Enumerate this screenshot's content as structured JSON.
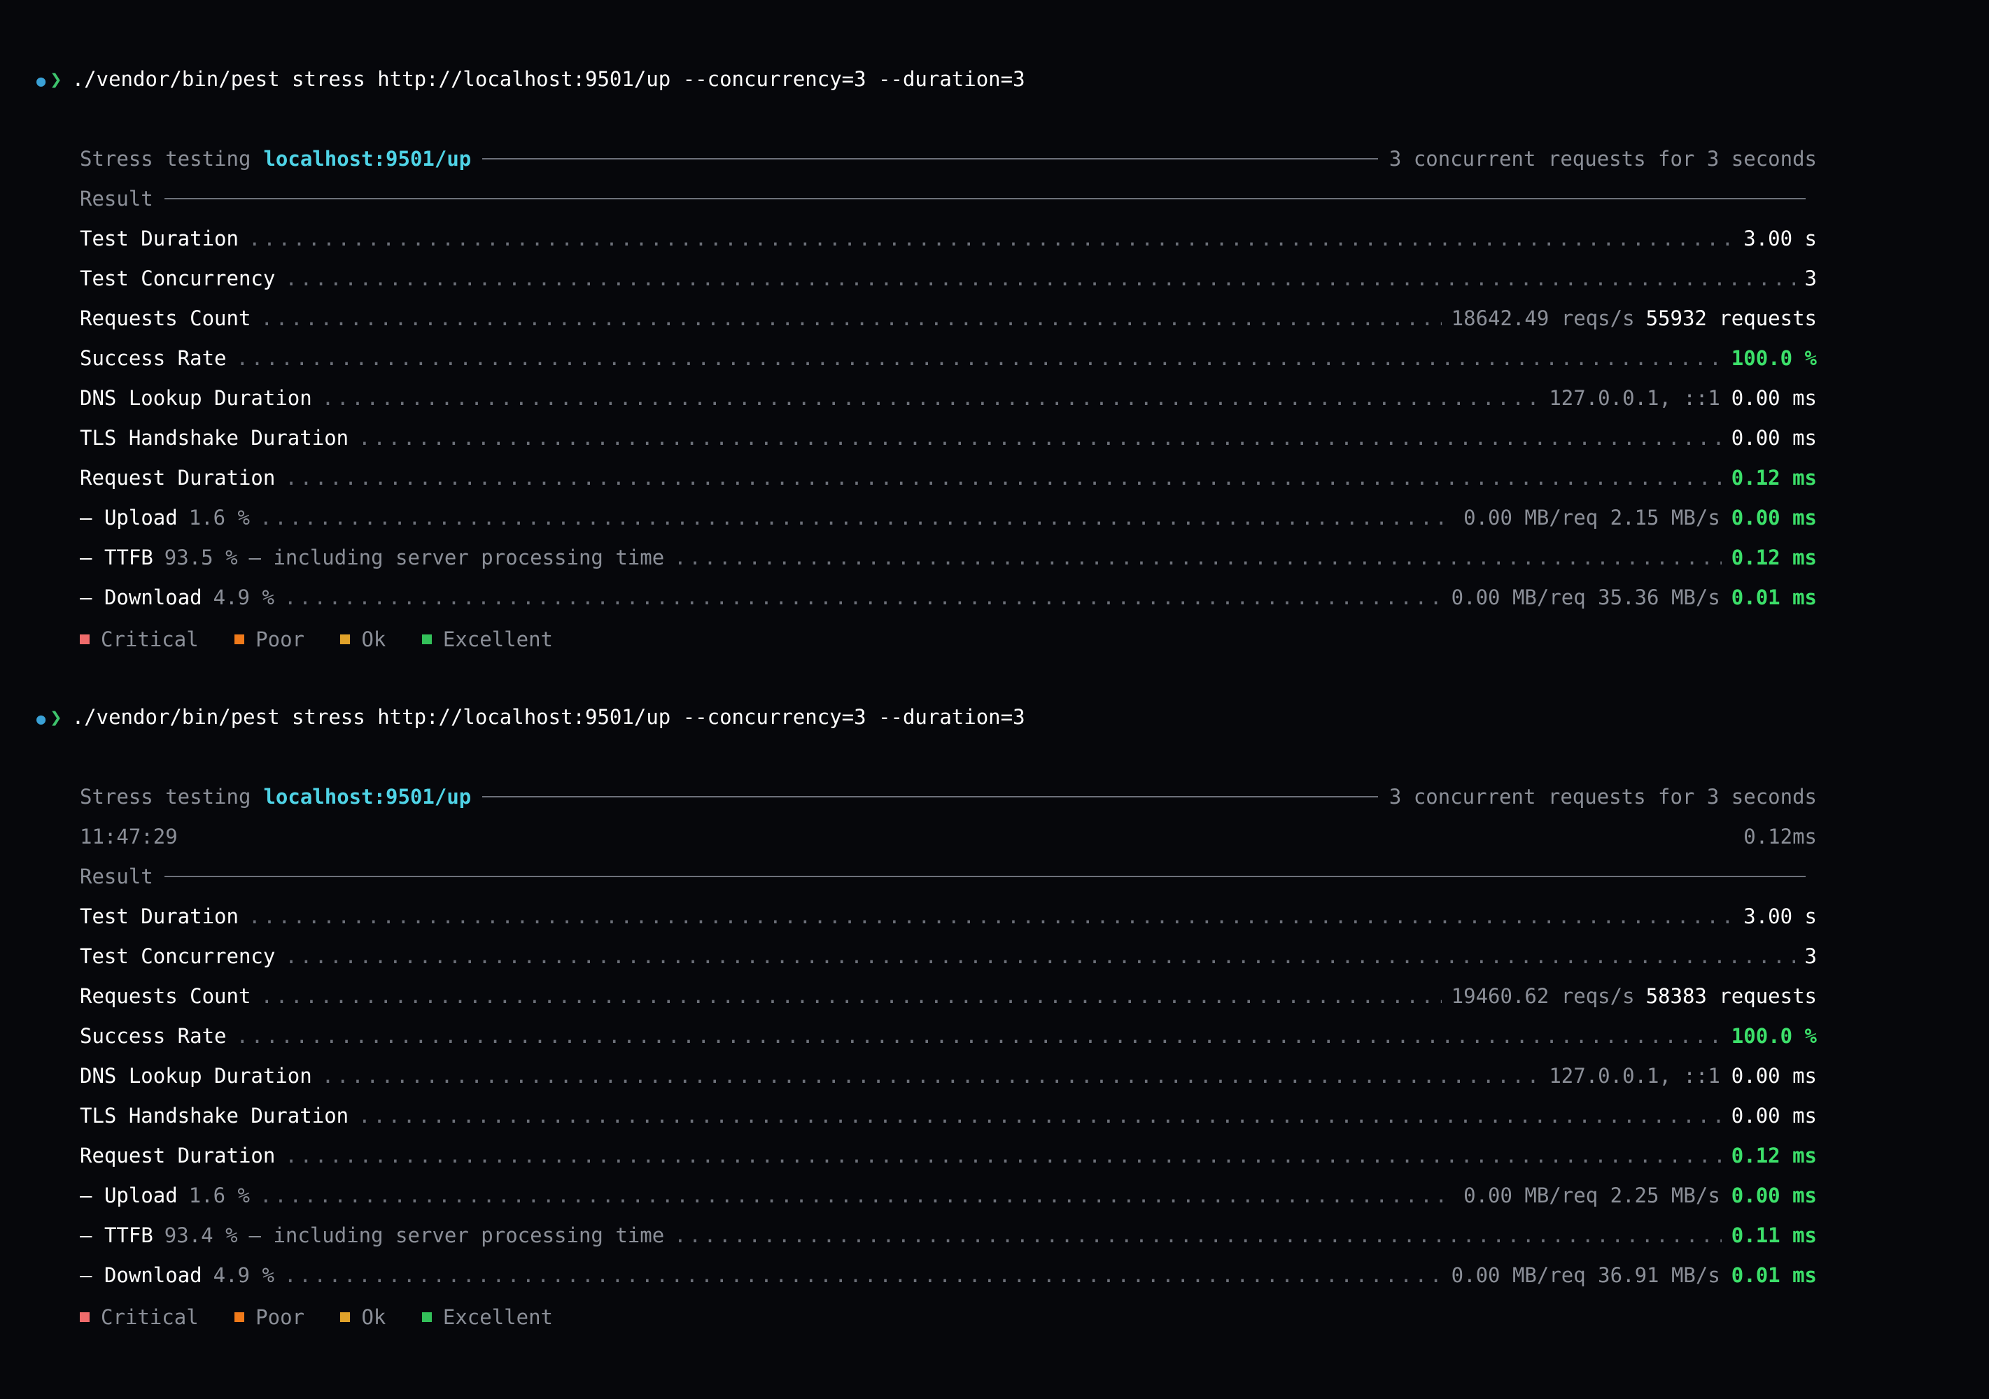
{
  "runs": [
    {
      "command": "./vendor/bin/pest stress http://localhost:9501/up --concurrency=3 --duration=3",
      "header": {
        "prefix": "Stress testing",
        "url": "localhost:9501/up",
        "summary": "3 concurrent requests for 3 seconds"
      },
      "section_title": "Result",
      "metrics": {
        "test_duration": {
          "label": "Test Duration",
          "value": "3.00 s"
        },
        "test_concurrency": {
          "label": "Test Concurrency",
          "value": "3"
        },
        "requests_count": {
          "label": "Requests Count",
          "rate": "18642.49 reqs/s",
          "value": "55932 requests"
        },
        "success_rate": {
          "label": "Success Rate",
          "value": "100.0 %"
        },
        "dns_lookup": {
          "label": "DNS Lookup Duration",
          "detail": "127.0.0.1, ::1",
          "value": "0.00 ms"
        },
        "tls_handshake": {
          "label": "TLS Handshake Duration",
          "value": "0.00 ms"
        },
        "request_duration": {
          "label": "Request Duration",
          "value": "0.12 ms"
        },
        "upload": {
          "label": "Upload",
          "percent": "1.6 %",
          "detail": "0.00 MB/req 2.15 MB/s",
          "value": "0.00 ms"
        },
        "ttfb": {
          "label": "TTFB",
          "percent": "93.5 %",
          "note": "— including server processing time",
          "value": "0.12 ms"
        },
        "download": {
          "label": "Download",
          "percent": "4.9 %",
          "detail": "0.00 MB/req 35.36 MB/s",
          "value": "0.01 ms"
        }
      }
    },
    {
      "command": "./vendor/bin/pest stress http://localhost:9501/up --concurrency=3 --duration=3",
      "header": {
        "prefix": "Stress testing",
        "url": "localhost:9501/up",
        "summary": "3 concurrent requests for 3 seconds"
      },
      "timestamp": "11:47:29",
      "latest": "0.12ms",
      "section_title": "Result",
      "metrics": {
        "test_duration": {
          "label": "Test Duration",
          "value": "3.00 s"
        },
        "test_concurrency": {
          "label": "Test Concurrency",
          "value": "3"
        },
        "requests_count": {
          "label": "Requests Count",
          "rate": "19460.62 reqs/s",
          "value": "58383 requests"
        },
        "success_rate": {
          "label": "Success Rate",
          "value": "100.0 %"
        },
        "dns_lookup": {
          "label": "DNS Lookup Duration",
          "detail": "127.0.0.1, ::1",
          "value": "0.00 ms"
        },
        "tls_handshake": {
          "label": "TLS Handshake Duration",
          "value": "0.00 ms"
        },
        "request_duration": {
          "label": "Request Duration",
          "value": "0.12 ms"
        },
        "upload": {
          "label": "Upload",
          "percent": "1.6 %",
          "detail": "0.00 MB/req 2.25 MB/s",
          "value": "0.00 ms"
        },
        "ttfb": {
          "label": "TTFB",
          "percent": "93.4 %",
          "note": "— including server processing time",
          "value": "0.11 ms"
        },
        "download": {
          "label": "Download",
          "percent": "4.9 %",
          "detail": "0.00 MB/req 36.91 MB/s",
          "value": "0.01 ms"
        }
      }
    }
  ],
  "prompt": {
    "dot": "●",
    "arrow": "❯",
    "dash": "–"
  },
  "legend": [
    {
      "label": "Critical",
      "color": "#ef6b6b"
    },
    {
      "label": "Poor",
      "color": "#f07a1a"
    },
    {
      "label": "Ok",
      "color": "#e0a22a"
    },
    {
      "label": "Excellent",
      "color": "#33c05a"
    }
  ],
  "colors": {
    "background": "#06070b",
    "good": "#3ce06a",
    "url": "#4fd3e6",
    "muted": "#8b8f98"
  }
}
